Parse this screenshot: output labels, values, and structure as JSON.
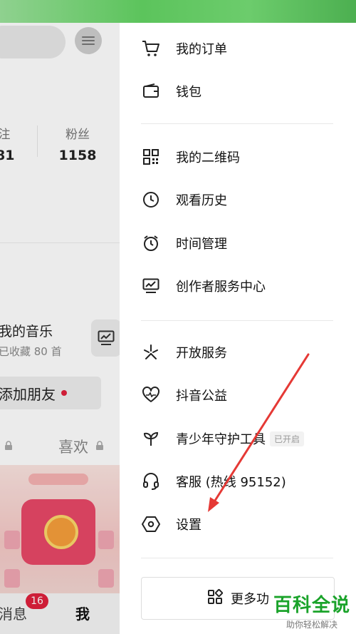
{
  "background": {
    "stats": [
      {
        "label": "注",
        "value": "81"
      },
      {
        "label": "粉丝",
        "value": "1158"
      }
    ],
    "music": {
      "title": "我的音乐",
      "subtitle": "已收藏 80 首"
    },
    "add_friend": "添加朋友",
    "tabs": {
      "like": "喜欢"
    },
    "bottom_nav": {
      "messages": "消息",
      "messages_badge": "16",
      "me": "我"
    }
  },
  "drawer": {
    "group1": [
      {
        "icon": "cart-icon",
        "label": "我的订单"
      },
      {
        "icon": "wallet-icon",
        "label": "钱包"
      }
    ],
    "group2": [
      {
        "icon": "qrcode-icon",
        "label": "我的二维码"
      },
      {
        "icon": "clock-icon",
        "label": "观看历史"
      },
      {
        "icon": "alarm-icon",
        "label": "时间管理"
      },
      {
        "icon": "creator-monitor-icon",
        "label": "创作者服务中心"
      }
    ],
    "group3": [
      {
        "icon": "open-service-icon",
        "label": "开放服务"
      },
      {
        "icon": "charity-heart-icon",
        "label": "抖音公益"
      },
      {
        "icon": "sprout-icon",
        "label": "青少年守护工具",
        "tag": "已开启"
      },
      {
        "icon": "headset-icon",
        "label": "客服 (热线 95152)"
      },
      {
        "icon": "settings-hex-icon",
        "label": "设置"
      }
    ],
    "more_button": "更多功"
  },
  "watermark": {
    "title": "百科全说",
    "subtitle": "助你轻松解决"
  },
  "colors": {
    "accent_red": "#e0203c",
    "watermark_green": "#1aa32a",
    "annotation_red": "#e53935"
  }
}
